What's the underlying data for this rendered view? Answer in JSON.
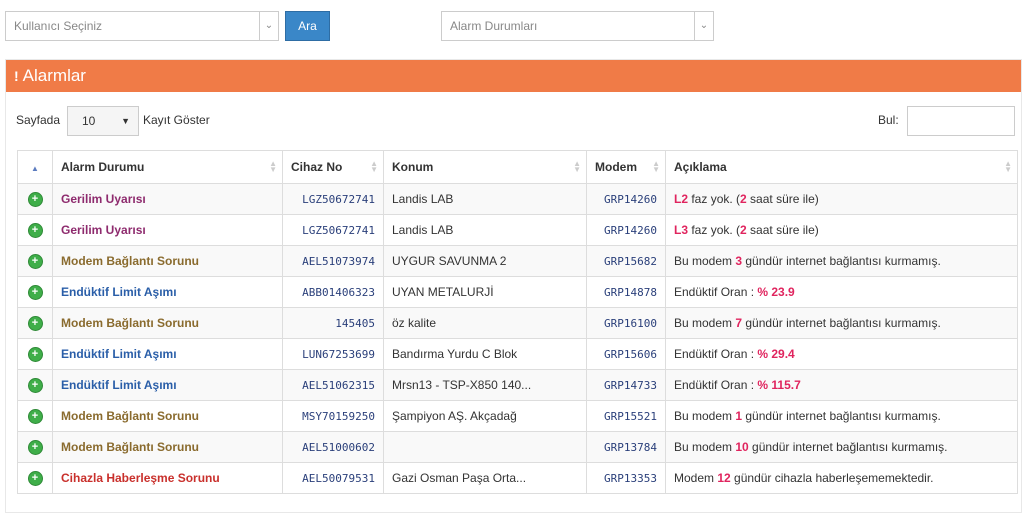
{
  "filters": {
    "user_placeholder": "Kullanıcı Seçiniz",
    "search_label": "Ara",
    "alarm_placeholder": "Alarm Durumları"
  },
  "panel": {
    "title": "Alarmlar",
    "length_prefix": "Sayfada",
    "length_value": "10",
    "length_suffix": "Kayıt Göster",
    "search_label": "Bul:"
  },
  "table": {
    "headers": [
      "Alarm Durumu",
      "Cihaz No",
      "Konum",
      "Modem",
      "Açıklama"
    ],
    "rows": [
      {
        "status": "Gerilim Uyarısı",
        "status_color": "#8e2b6e",
        "device": "LGZ50672741",
        "location": "Landis LAB",
        "modem": "GRP14260",
        "desc_pre": "",
        "desc_hl": "L2",
        "desc_mid": " faz yok. (",
        "desc_hl2": "2",
        "desc_post": " saat süre ile)"
      },
      {
        "status": "Gerilim Uyarısı",
        "status_color": "#8e2b6e",
        "device": "LGZ50672741",
        "location": "Landis LAB",
        "modem": "GRP14260",
        "desc_pre": "",
        "desc_hl": "L3",
        "desc_mid": " faz yok. (",
        "desc_hl2": "2",
        "desc_post": " saat süre ile)"
      },
      {
        "status": "Modem Bağlantı Sorunu",
        "status_color": "#8a6b2e",
        "device": "AEL51073974",
        "location": "UYGUR SAVUNMA 2",
        "modem": "GRP15682",
        "desc_pre": "Bu modem ",
        "desc_hl": "3",
        "desc_mid": " gündür internet bağlantısı kurmamış.",
        "desc_hl2": "",
        "desc_post": ""
      },
      {
        "status": "Endüktif Limit Aşımı",
        "status_color": "#2a5ea8",
        "device": "ABB01406323",
        "location": "UYAN METALURJİ",
        "modem": "GRP14878",
        "desc_pre": "Endüktif Oran : ",
        "desc_hl": "% 23.9",
        "desc_mid": "",
        "desc_hl2": "",
        "desc_post": ""
      },
      {
        "status": "Modem Bağlantı Sorunu",
        "status_color": "#8a6b2e",
        "device": "145405",
        "location": "öz kalite",
        "modem": "GRP16100",
        "desc_pre": "Bu modem ",
        "desc_hl": "7",
        "desc_mid": " gündür internet bağlantısı kurmamış.",
        "desc_hl2": "",
        "desc_post": ""
      },
      {
        "status": "Endüktif Limit Aşımı",
        "status_color": "#2a5ea8",
        "device": "LUN67253699",
        "location": "Bandırma Yurdu C Blok",
        "modem": "GRP15606",
        "desc_pre": "Endüktif Oran : ",
        "desc_hl": "% 29.4",
        "desc_mid": "",
        "desc_hl2": "",
        "desc_post": ""
      },
      {
        "status": "Endüktif Limit Aşımı",
        "status_color": "#2a5ea8",
        "device": "AEL51062315",
        "location": "Mrsn13 - TSP-X850 140...",
        "modem": "GRP14733",
        "desc_pre": "Endüktif Oran : ",
        "desc_hl": "% 115.7",
        "desc_mid": "",
        "desc_hl2": "",
        "desc_post": ""
      },
      {
        "status": "Modem Bağlantı Sorunu",
        "status_color": "#8a6b2e",
        "device": "MSY70159250",
        "location": "Şampiyon AŞ. Akçadağ",
        "modem": "GRP15521",
        "desc_pre": "Bu modem ",
        "desc_hl": "1",
        "desc_mid": " gündür internet bağlantısı kurmamış.",
        "desc_hl2": "",
        "desc_post": ""
      },
      {
        "status": "Modem Bağlantı Sorunu",
        "status_color": "#8a6b2e",
        "device": "AEL51000602",
        "location": "",
        "modem": "GRP13784",
        "desc_pre": "Bu modem ",
        "desc_hl": "10",
        "desc_mid": " gündür internet bağlantısı kurmamış.",
        "desc_hl2": "",
        "desc_post": ""
      },
      {
        "status": "Cihazla Haberleşme Sorunu",
        "status_color": "#c9302c",
        "device": "AEL50079531",
        "location": "Gazi Osman Paşa Orta...",
        "modem": "GRP13353",
        "desc_pre": "Modem ",
        "desc_hl": "12",
        "desc_mid": " gündür cihazla haberleşememektedir.",
        "desc_hl2": "",
        "desc_post": ""
      }
    ]
  },
  "icons": {
    "expand": "plus-circle-icon",
    "caret": "chevron-down-icon",
    "sort": "sort-icon",
    "alert": "exclamation-icon"
  },
  "colors": {
    "accent": "#f07b47",
    "button": "#3a87c8",
    "highlight": "#e0245e"
  }
}
